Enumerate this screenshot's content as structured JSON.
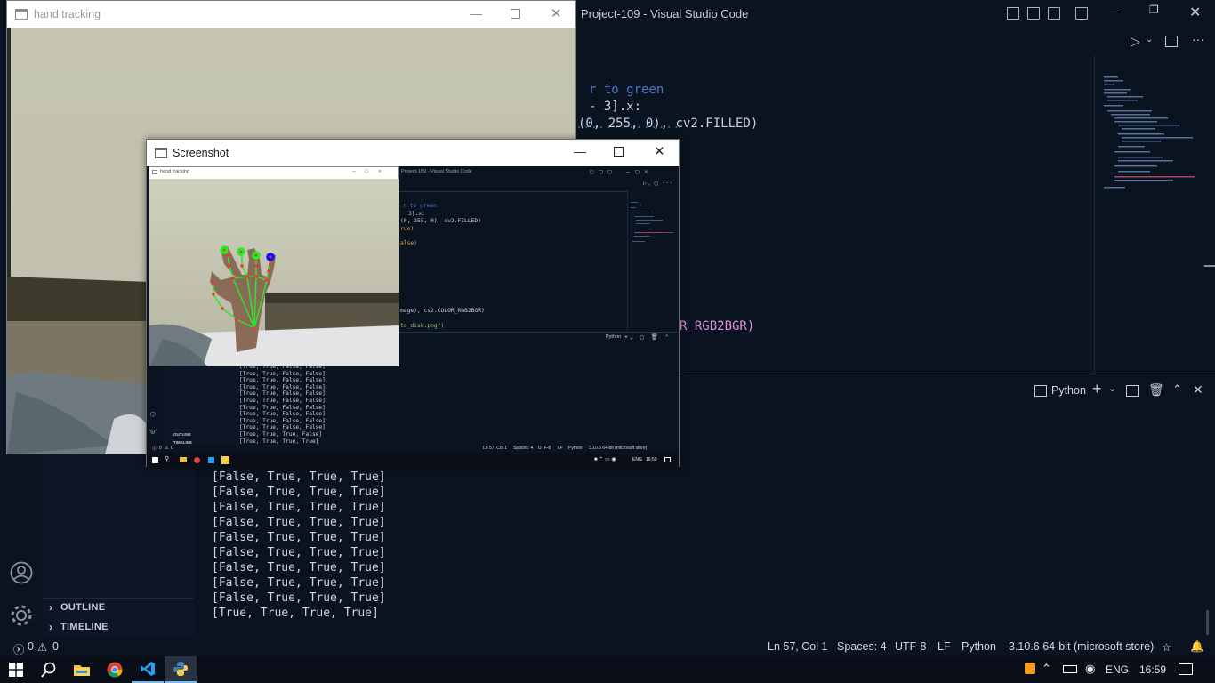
{
  "vscode": {
    "title": "Project-109 - Visual Studio Code",
    "code_lines": [
      {
        "text": "r to green",
        "color": "#4f74c8"
      },
      {
        "text": "- 3].x:",
        "color": "#c8d0de"
      },
      {
        "text": "(0, 255, 0), cv2.FILLED)",
        "color": "#c8d0de"
      },
      {
        "text": "R_RGB2BGR)",
        "color": "#e28fdc"
      }
    ],
    "panel": {
      "terminal_label": "Python"
    },
    "terminal_lines": [
      "[False, True, True, True]",
      "[False, True, True, True]",
      "[False, True, True, True]",
      "[False, True, True, True]",
      "[False, True, True, True]",
      "[False, True, True, True]",
      "[False, True, True, True]",
      "[False, True, True, True]",
      "[False, True, True, True]",
      "[True, True, True, True]"
    ],
    "sidebar": {
      "outline": "OUTLINE",
      "timeline": "TIMELINE"
    },
    "statusbar": {
      "errors": "0",
      "warnings": "0",
      "position": "Ln 57, Col 1",
      "spaces": "Spaces: 4",
      "encoding": "UTF-8",
      "eol": "LF",
      "language": "Python",
      "interpreter": "3.10.6 64-bit (microsoft store)"
    }
  },
  "taskbar": {
    "lang": "ENG",
    "time": "16:59"
  },
  "hand_window": {
    "title": "hand tracking"
  },
  "screenshot_window": {
    "title": "Screenshot",
    "inner_hand_title": "hand tracking",
    "inner_vscode_title": "Project-109 - Visual Studio Code",
    "inner_code_lines": [
      {
        "text": "r to green",
        "color": "#4f74c8"
      },
      {
        "text": "3].x:",
        "color": "#c8d0de"
      },
      {
        "text": "(0, 255, 0), cv2.FILLED)",
        "color": "#c8d0de"
      },
      {
        "text": "rue)",
        "color": "#e0a84a"
      },
      {
        "text": "alse)",
        "color": "#e0a84a"
      },
      {
        "text": "mage), cv2.COLOR_RGB2BGR)",
        "color": "#c8d0de"
      },
      {
        "text": "to_disk.png\")",
        "color": "#8fc27a"
      }
    ],
    "inner_terminal_label": "Python",
    "inner_terminal_lines": [
      "[True, True, False, False]",
      "[True, True, False, False]",
      "[True, True, False, False]",
      "[True, True, False, False]",
      "[True, True, False, False]",
      "[True, True, False, False]",
      "[True, True, False, False]",
      "[True, True, False, False]",
      "[True, True, False, False]",
      "[True, True, False, False]",
      "[True, True, True, False]",
      "[True, True, True, True]"
    ],
    "inner_outline": "OUTLINE",
    "inner_timeline": "TIMELINE",
    "inner_errors": "0",
    "inner_warnings": "0",
    "inner_status": {
      "position": "Ln 57, Col 1",
      "spaces": "Spaces: 4",
      "encoding": "UTF-8",
      "eol": "LF",
      "language": "Python",
      "interpreter": "3.10.6 64-bit (microsoft store)"
    },
    "inner_lang": "ENG",
    "inner_time": "16:59"
  },
  "colors": {
    "landmark_line": "#2ce62c",
    "landmark_point": "#ff3030",
    "fingertip_green": "#22ee22",
    "fingertip_blue": "#1111ff"
  }
}
